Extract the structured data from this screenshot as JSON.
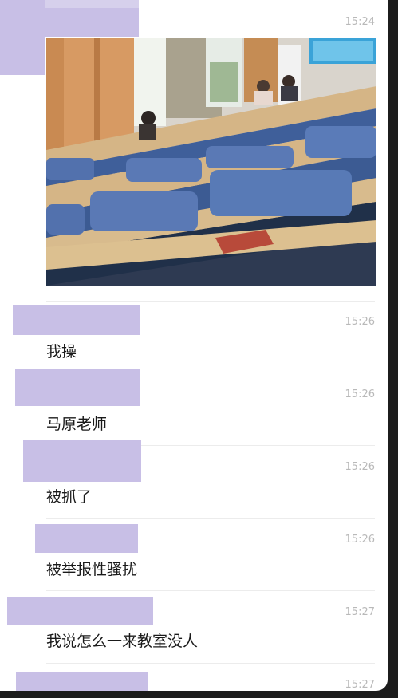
{
  "colors": {
    "redaction": "#c8bfe6",
    "timestamp": "#b9b9b9",
    "text": "#1a1a1a",
    "background": "#ffffff"
  },
  "messages": [
    {
      "time": "15:24",
      "type": "image",
      "image_icon": "classroom-photo"
    },
    {
      "time": "15:26",
      "text": "我操"
    },
    {
      "time": "15:26",
      "text": "马原老师"
    },
    {
      "time": "15:26",
      "text": "被抓了"
    },
    {
      "time": "15:26",
      "text": "被举报性骚扰"
    },
    {
      "time": "15:27",
      "text": "我说怎么一来教室没人"
    },
    {
      "time": "15:27",
      "text": ""
    }
  ]
}
